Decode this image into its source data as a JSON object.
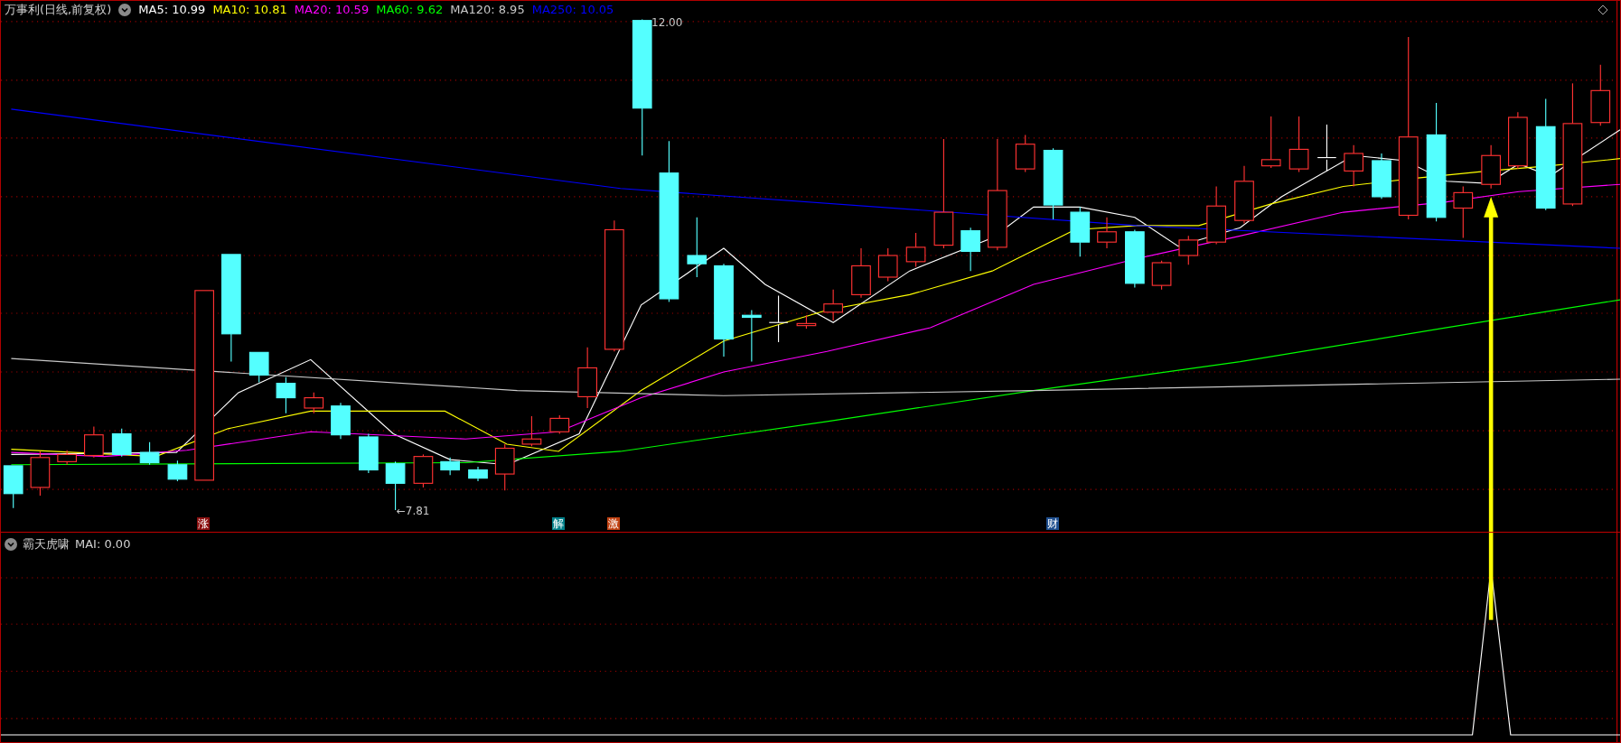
{
  "chart": {
    "title": "万事利(日线,前复权)",
    "indicators": [
      {
        "label": "MA5: 10.99",
        "color": "#ffffff"
      },
      {
        "label": "MA10: 10.81",
        "color": "#ffff00"
      },
      {
        "label": "MA20: 10.59",
        "color": "#ff00ff"
      },
      {
        "label": "MA60: 9.62",
        "color": "#00ff00"
      },
      {
        "label": "MA120: 8.95",
        "color": "#c8c8c8"
      },
      {
        "label": "MA250: 10.05",
        "color": "#0000ff"
      }
    ],
    "price_labels": [
      {
        "text": "12.00"
      },
      {
        "text": "←7.81"
      }
    ],
    "event_markers": [
      {
        "text": "涨",
        "color": "#8b1010"
      },
      {
        "text": "解",
        "color": "#00808a"
      },
      {
        "text": "激",
        "color": "#c04010"
      },
      {
        "text": "财",
        "color": "#1f4f8f"
      }
    ]
  },
  "indicator_panel": {
    "title": "霸天虎啸",
    "reading": "MAI: 0.00"
  }
}
